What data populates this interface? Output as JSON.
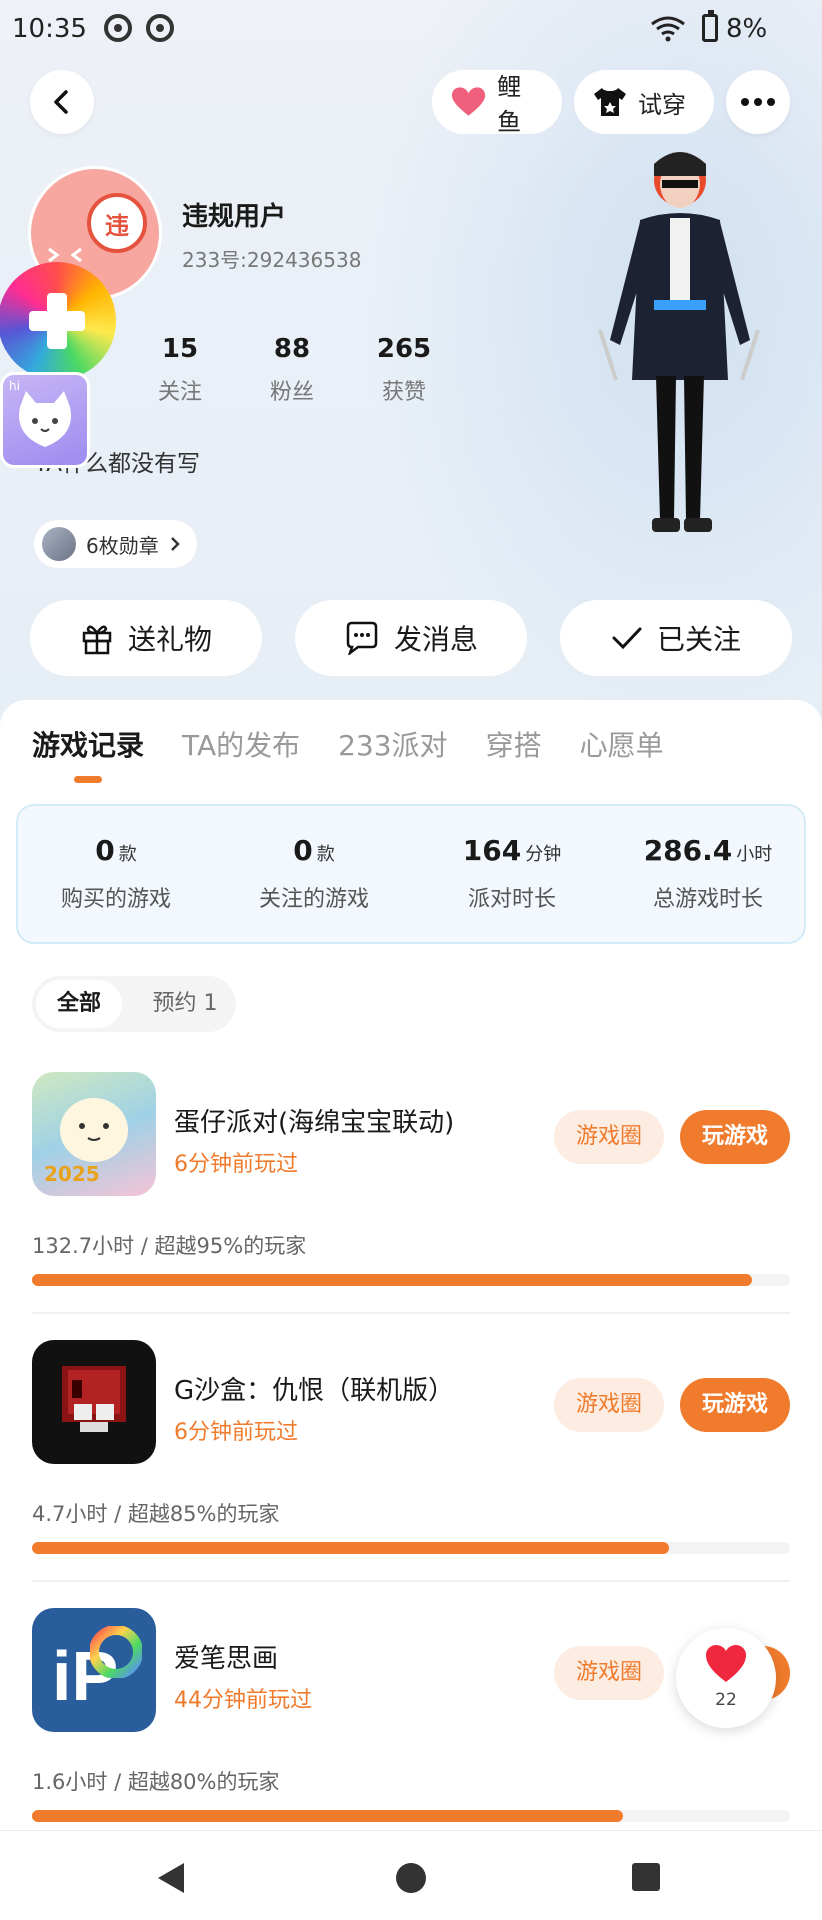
{
  "status_bar": {
    "time": "10:35",
    "battery": "8%"
  },
  "top_bar": {
    "fish_label": "鲤鱼",
    "tryon_label": "试穿"
  },
  "profile": {
    "name": "违规用户",
    "avatar_badge": "违",
    "uid": "233号:292436538",
    "bio": "TA什么都没有写",
    "stats": [
      {
        "num": "15",
        "label": "关注"
      },
      {
        "num": "88",
        "label": "粉丝"
      },
      {
        "num": "265",
        "label": "获赞"
      }
    ],
    "medal_label": "6枚勋章",
    "float_cat_label": "hi"
  },
  "actions": {
    "gift": "送礼物",
    "message": "发消息",
    "followed": "已关注"
  },
  "tabs": [
    "游戏记录",
    "TA的发布",
    "233派对",
    "穿搭",
    "心愿单"
  ],
  "summary": [
    {
      "value": "0",
      "unit": "款",
      "label": "购买的游戏"
    },
    {
      "value": "0",
      "unit": "款",
      "label": "关注的游戏"
    },
    {
      "value": "164",
      "unit": "分钟",
      "label": "派对时长"
    },
    {
      "value": "286.4",
      "unit": "小时",
      "label": "总游戏时长"
    }
  ],
  "filters": {
    "all": "全部",
    "reserve": "预约 1"
  },
  "game_buttons": {
    "circle": "游戏圈",
    "play": "玩游戏"
  },
  "games": [
    {
      "name": "蛋仔派对(海绵宝宝联动)",
      "played": "6分钟前玩过",
      "stat": "132.7小时 / 超越95%的玩家",
      "progress": 0.95,
      "icon_text": "2025"
    },
    {
      "name": "G沙盒：仇恨（联机版）",
      "played": "6分钟前玩过",
      "stat": "4.7小时 / 超越85%的玩家",
      "progress": 0.84
    },
    {
      "name": "爱笔思画",
      "played": "44分钟前玩过",
      "stat": "1.6小时 / 超越80%的玩家",
      "progress": 0.78,
      "icon_text": "iP"
    }
  ],
  "like_count": "22",
  "colors": {
    "accent": "#f07b2c",
    "summary_bg": "#f2f8fd"
  }
}
